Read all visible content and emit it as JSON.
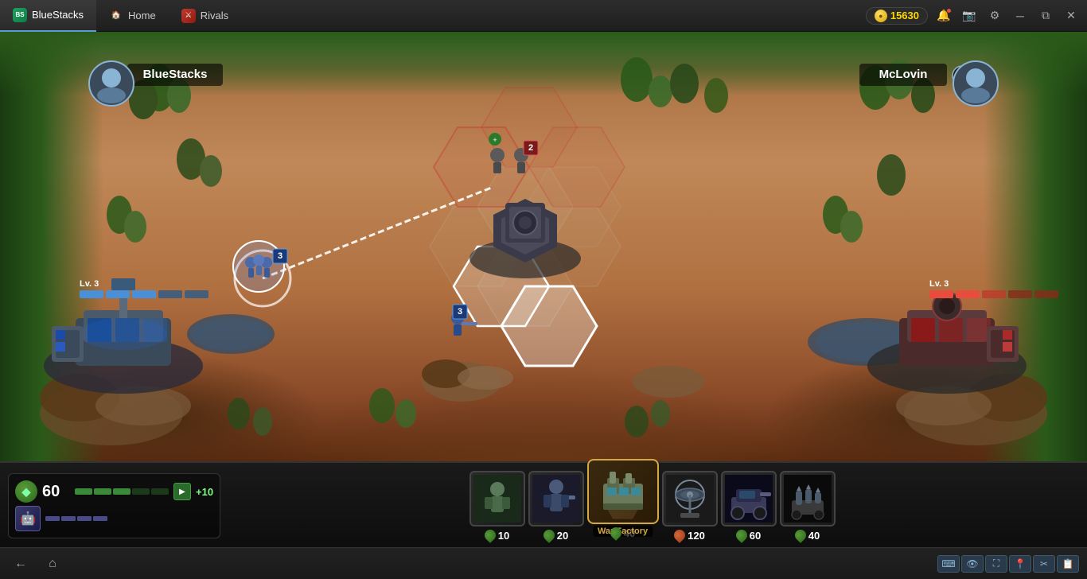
{
  "titlebar": {
    "app_name": "BlueStacks",
    "home_tab": "Home",
    "game_tab": "Rivals",
    "coins": "15630",
    "buttons": [
      "minimize",
      "restore",
      "close"
    ]
  },
  "game": {
    "player_left": {
      "name": "BlueStacks",
      "avatar": "👨",
      "health_label": "Lv. 3",
      "health_segments": 5
    },
    "player_right": {
      "name": "McLovin",
      "avatar": "👨",
      "health_label": "Lv. 3",
      "health_segments": 5
    },
    "units": [
      {
        "id": "infantry",
        "emoji": "🪖",
        "cost": "10",
        "cost_type": "green"
      },
      {
        "id": "rifleman",
        "emoji": "🔫",
        "cost": "20",
        "cost_type": "green"
      },
      {
        "id": "war-factory",
        "emoji": "🏭",
        "cost": "40",
        "label": "War Factory",
        "selected": true
      },
      {
        "id": "artillery",
        "emoji": "🎯",
        "cost": "120",
        "cost_type": "orange"
      },
      {
        "id": "vehicle",
        "emoji": "🚗",
        "cost": "60",
        "cost_type": "green"
      },
      {
        "id": "missile",
        "emoji": "🚀",
        "cost": "40",
        "cost_type": "green"
      }
    ]
  },
  "resources": {
    "count": "60",
    "income": "+10",
    "bar_filled": 3,
    "bar_total": 5
  },
  "taskbar": {
    "back_label": "←",
    "home_label": "⌂",
    "icons": [
      "⌨",
      "👁",
      "⛶",
      "📍",
      "✂",
      "📋"
    ]
  }
}
